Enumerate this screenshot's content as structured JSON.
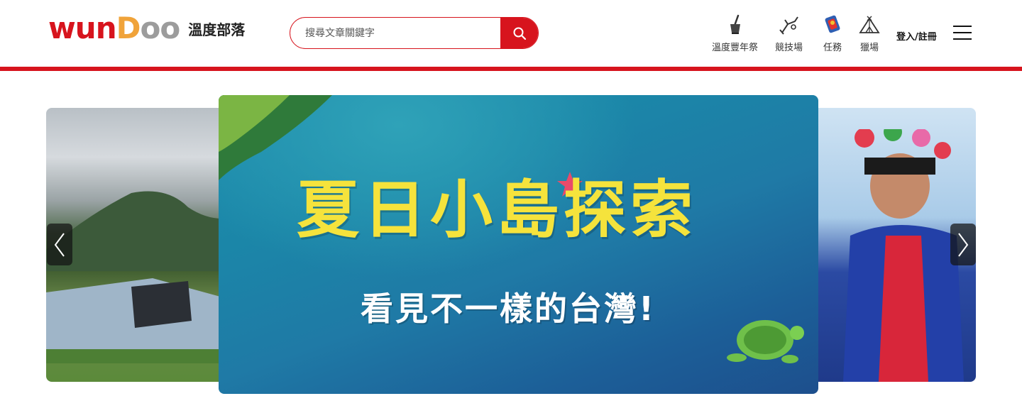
{
  "header": {
    "logo_text": "wunDoo",
    "logo_subtitle": "溫度部落",
    "brand_color": "#d7141d",
    "search": {
      "placeholder": "搜尋文章關鍵字",
      "button_icon": "search-icon"
    },
    "nav": [
      {
        "label": "溫度豐年祭",
        "icon": "mortar-pestle-icon"
      },
      {
        "label": "競技場",
        "icon": "slingshot-icon"
      },
      {
        "label": "任務",
        "icon": "task-badge-icon"
      },
      {
        "label": "獵場",
        "icon": "tent-icon"
      }
    ],
    "login_label": "登入/註冊",
    "menu_icon": "hamburger-menu-icon"
  },
  "carousel": {
    "slides": [
      {
        "name": "camping-slide",
        "caption": ""
      },
      {
        "name": "summer-island-slide",
        "title": "夏日小島探索",
        "subtitle": "看見不一樣的台灣!"
      },
      {
        "name": "festival-slide",
        "caption": ""
      }
    ],
    "prev_icon": "chevron-left-icon",
    "next_icon": "chevron-right-icon"
  }
}
